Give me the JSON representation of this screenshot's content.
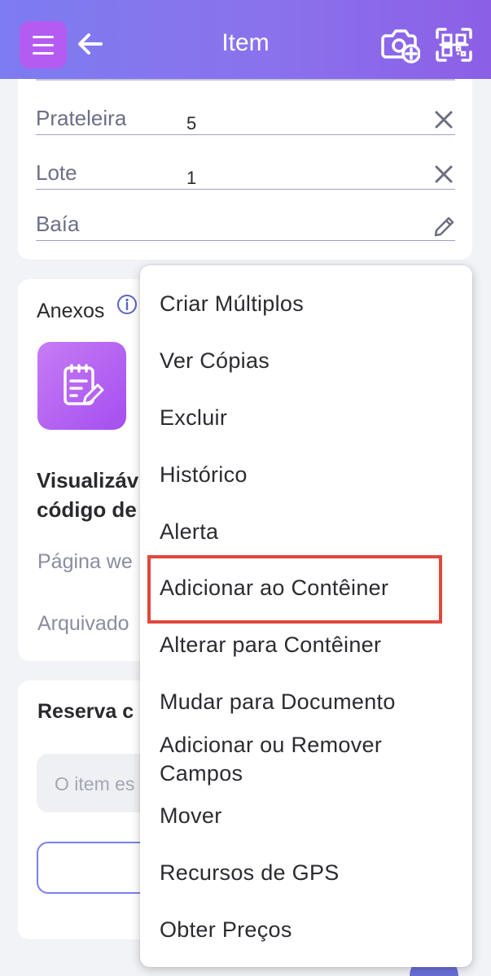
{
  "header": {
    "title": "Item"
  },
  "fields": [
    {
      "label": "Prateleira",
      "value": "5",
      "action_icon": "close-icon"
    },
    {
      "label": "Lote",
      "value": "1",
      "action_icon": "close-icon"
    },
    {
      "label": "Baía",
      "value": "",
      "action_icon": "pencil-icon"
    }
  ],
  "attachments": {
    "title": "Anexos",
    "visible_label_line1": "Visualizáv",
    "visible_label_line2": "código de",
    "web_page": "Página we",
    "archived": "Arquivado"
  },
  "reservation": {
    "title": "Reserva c",
    "input_placeholder": "O item es"
  },
  "menu": {
    "items": [
      "Criar Múltiplos",
      "Ver Cópias",
      "Excluir",
      "Histórico",
      "Alerta",
      "Adicionar ao Contêiner",
      "Alterar para Contêiner",
      "Mudar para Documento",
      "Adicionar ou Remover Campos",
      "Mover",
      "Recursos de GPS",
      "Obter Preços"
    ],
    "highlighted_item": "Adicionar ao Contêiner"
  },
  "colors": {
    "header_start": "#7d7cf0",
    "header_end": "#8c5fe6",
    "menu_button": "#b45cf2",
    "highlight_border": "#e0483c"
  }
}
